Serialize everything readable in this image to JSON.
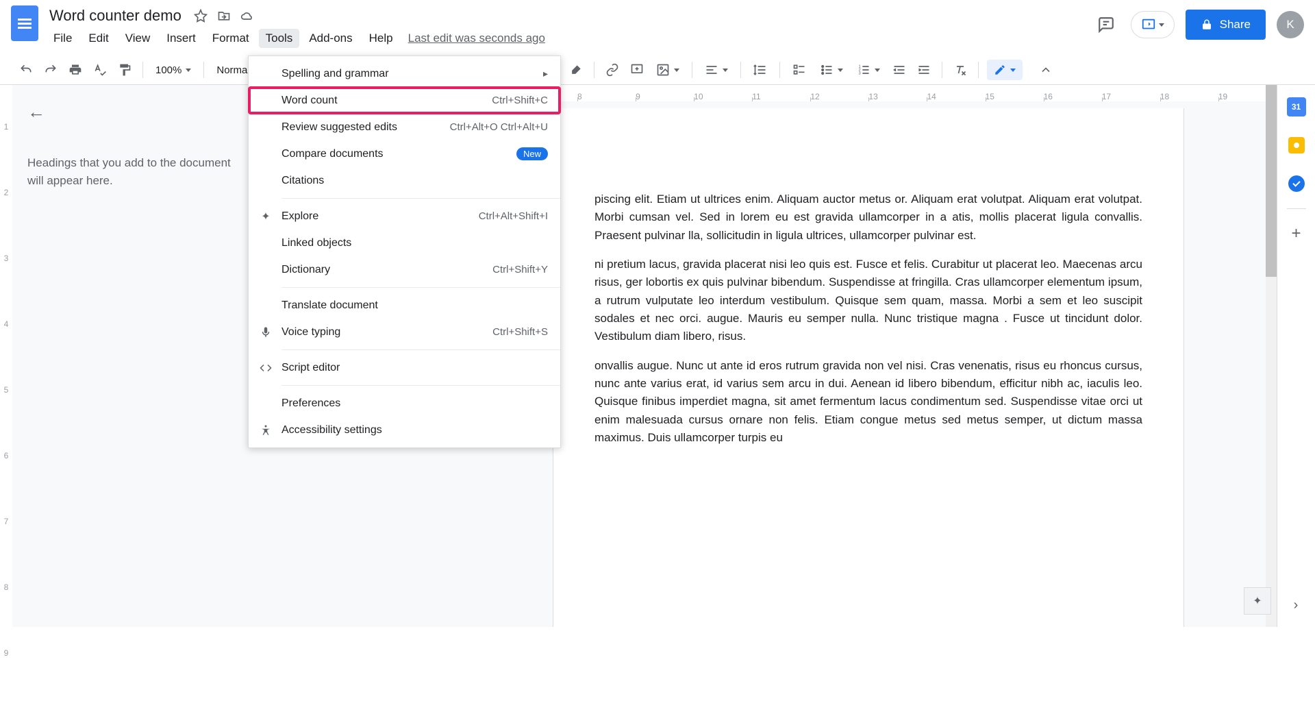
{
  "app": {
    "doc_title": "Word counter demo",
    "last_edit": "Last edit was seconds ago",
    "share_label": "Share",
    "avatar_initial": "K"
  },
  "menubar": [
    "File",
    "Edit",
    "View",
    "Insert",
    "Format",
    "Tools",
    "Add-ons",
    "Help"
  ],
  "toolbar": {
    "zoom": "100%",
    "style": "Normal"
  },
  "outline": {
    "hint": "Headings that you add to the document will appear here."
  },
  "dropdown": {
    "items": [
      {
        "label": "Spelling and grammar",
        "submenu": true
      },
      {
        "label": "Word count",
        "shortcut": "Ctrl+Shift+C",
        "highlight": true
      },
      {
        "label": "Review suggested edits",
        "shortcut": "Ctrl+Alt+O Ctrl+Alt+U"
      },
      {
        "label": "Compare documents",
        "badge": "New"
      },
      {
        "label": "Citations"
      },
      {
        "divider": true
      },
      {
        "label": "Explore",
        "shortcut": "Ctrl+Alt+Shift+I",
        "icon": "explore"
      },
      {
        "label": "Linked objects"
      },
      {
        "label": "Dictionary",
        "shortcut": "Ctrl+Shift+Y"
      },
      {
        "divider": true
      },
      {
        "label": "Translate document"
      },
      {
        "label": "Voice typing",
        "shortcut": "Ctrl+Shift+S",
        "icon": "mic"
      },
      {
        "divider": true
      },
      {
        "label": "Script editor",
        "icon": "code"
      },
      {
        "divider": true
      },
      {
        "label": "Preferences"
      },
      {
        "label": "Accessibility settings",
        "icon": "accessibility"
      }
    ]
  },
  "ruler": {
    "h_start": 8,
    "h_end": 19,
    "v_start": 1,
    "v_end": 9
  },
  "sidepanel": {
    "calendar_day": "31"
  },
  "document": {
    "p1": "piscing elit. Etiam ut ultrices enim. Aliquam auctor metus or. Aliquam erat volutpat. Aliquam erat volutpat. Morbi cumsan vel. Sed in lorem eu est gravida ullamcorper in a atis, mollis placerat ligula convallis. Praesent pulvinar lla, sollicitudin in ligula ultrices, ullamcorper pulvinar est.",
    "p2": "ni pretium lacus, gravida placerat nisi leo quis est. Fusce et felis. Curabitur ut placerat leo. Maecenas arcu risus, ger lobortis ex quis pulvinar bibendum. Suspendisse at fringilla. Cras ullamcorper elementum ipsum, a rutrum vulputate leo interdum vestibulum. Quisque sem quam, massa. Morbi a sem et leo suscipit sodales et nec orci. augue. Mauris eu semper nulla. Nunc tristique magna . Fusce ut tincidunt dolor. Vestibulum diam libero, risus.",
    "p3": "onvallis augue. Nunc ut ante id eros rutrum gravida non vel nisi. Cras venenatis, risus eu rhoncus cursus, nunc ante varius erat, id varius sem arcu in dui. Aenean id libero bibendum, efficitur nibh ac, iaculis leo. Quisque finibus imperdiet magna, sit amet fermentum lacus condimentum sed. Suspendisse vitae orci ut enim malesuada cursus ornare non felis. Etiam congue metus sed metus semper, ut dictum massa maximus. Duis ullamcorper turpis eu"
  }
}
